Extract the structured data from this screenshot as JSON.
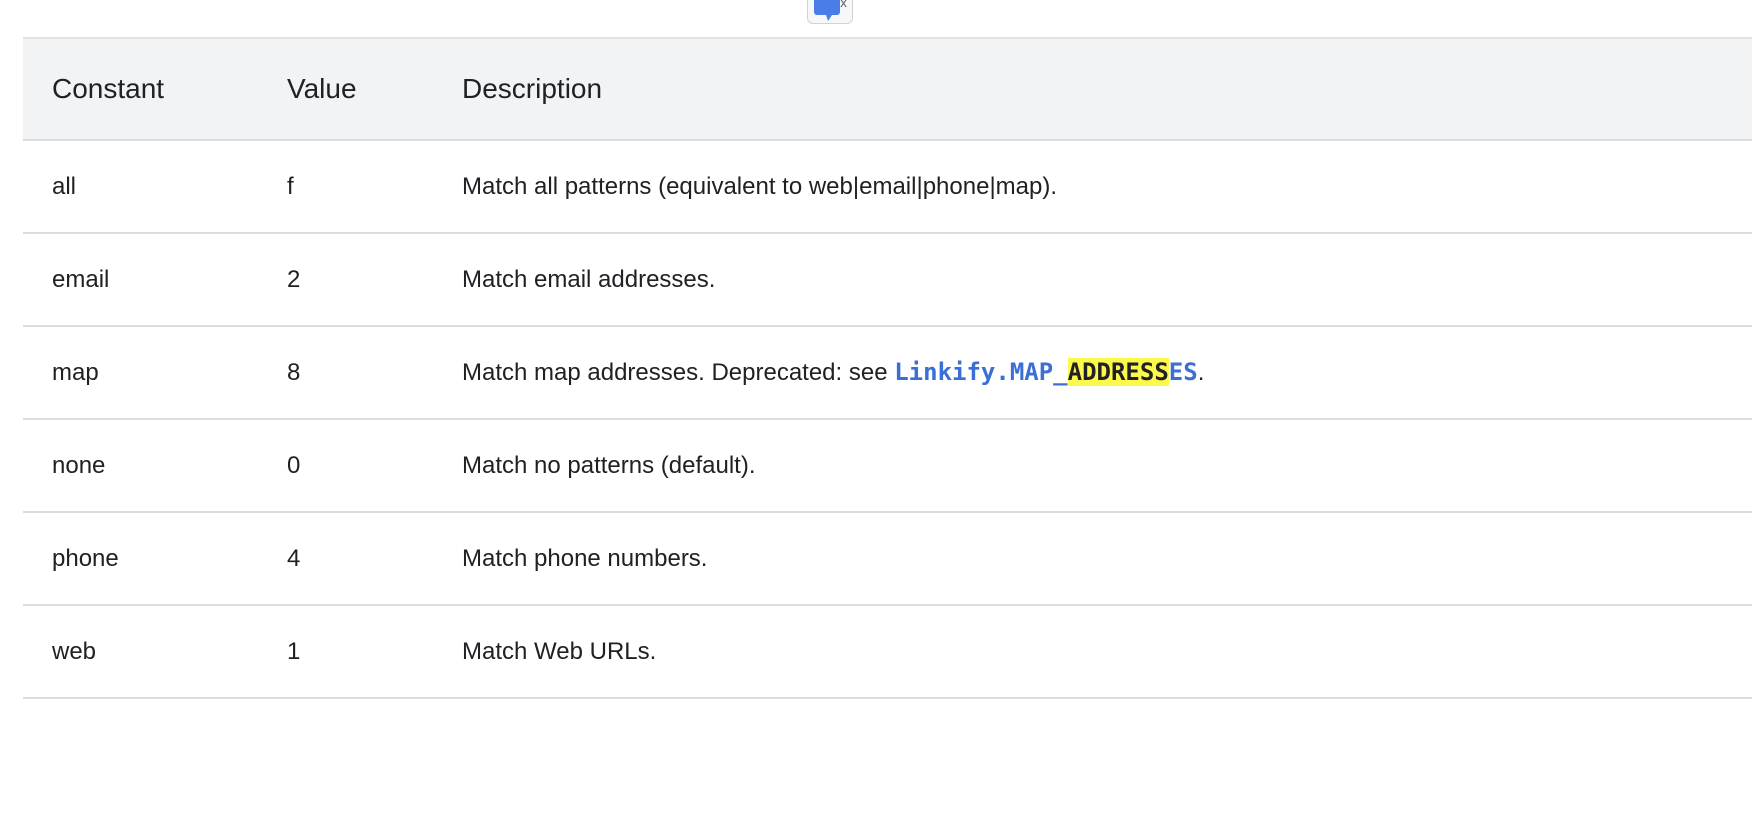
{
  "table": {
    "headers": [
      "Constant",
      "Value",
      "Description"
    ],
    "rows": [
      {
        "constant": "all",
        "value": "f",
        "description": "Match all patterns (equivalent to web|email|phone|map)."
      },
      {
        "constant": "email",
        "value": "2",
        "description": "Match email addresses."
      },
      {
        "constant": "map",
        "value": "8",
        "description_prefix": "Match map addresses. Deprecated: see ",
        "link_part1": "Linkify.MAP_",
        "link_highlight": "ADDRESS",
        "link_part2": "ES",
        "description_suffix": "."
      },
      {
        "constant": "none",
        "value": "0",
        "description": "Match no patterns (default)."
      },
      {
        "constant": "phone",
        "value": "4",
        "description": "Match phone numbers."
      },
      {
        "constant": "web",
        "value": "1",
        "description": "Match Web URLs."
      }
    ]
  },
  "colors": {
    "header_bg": "#f1f3f4",
    "link": "#3b6fd6",
    "highlight": "#fdf94a",
    "border": "#dadce0"
  },
  "icons": {
    "translate_widget": "google-translate-icon"
  }
}
